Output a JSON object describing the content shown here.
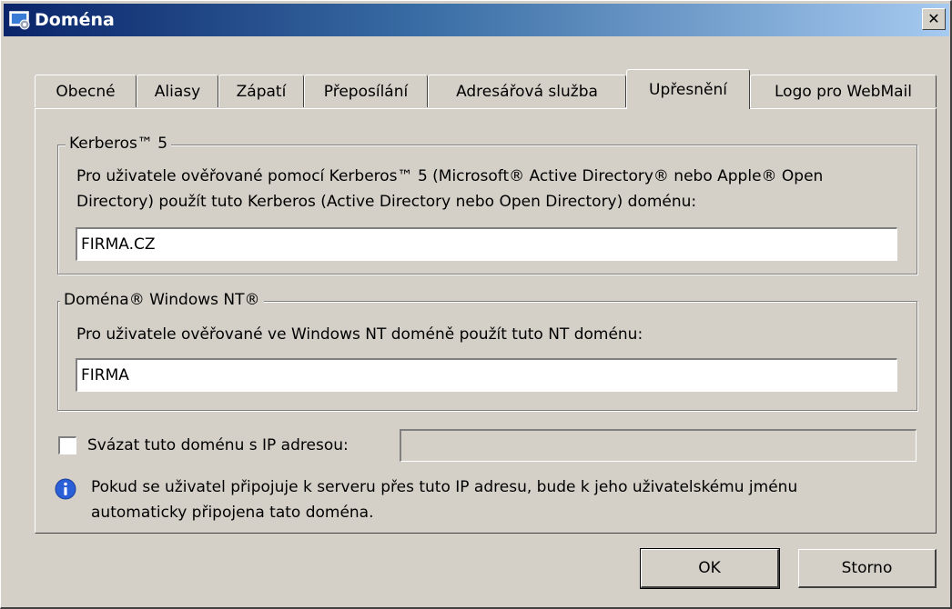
{
  "window": {
    "title": "Doména",
    "close_label": "✕",
    "icon": "domain-app-icon"
  },
  "tabs": [
    {
      "label": "Obecné",
      "active": false
    },
    {
      "label": "Aliasy",
      "active": false
    },
    {
      "label": "Zápatí",
      "active": false
    },
    {
      "label": "Přeposílání",
      "active": false
    },
    {
      "label": "Adresářová služba",
      "active": false
    },
    {
      "label": "Upřesnění",
      "active": true
    },
    {
      "label": "Logo pro WebMail",
      "active": false
    }
  ],
  "kerberos": {
    "legend": "Kerberos™ 5",
    "desc_line1": "Pro uživatele ověřované pomocí Kerberos™ 5 (Microsoft® Active Directory® nebo Apple® Open",
    "desc_line2": "Directory) použít tuto Kerberos (Active Directory nebo Open Directory) doménu:",
    "value": "FIRMA.CZ"
  },
  "nt": {
    "legend": "Doména® Windows NT®",
    "desc": "Pro uživatele ověřované ve Windows NT doméně použít tuto NT doménu:",
    "value": "FIRMA"
  },
  "bind_ip": {
    "label": "Svázat tuto doménu s IP adresou:",
    "checked": false,
    "value": ""
  },
  "info": {
    "icon": "info-icon",
    "line1": "Pokud se uživatel připojuje k serveru přes tuto IP adresu, bude k jeho uživatelskému jménu",
    "line2": "automaticky připojena tato doména."
  },
  "buttons": {
    "ok": "OK",
    "cancel": "Storno"
  },
  "colors": {
    "title_start": "#0a246a",
    "title_end": "#a6caf0",
    "face": "#d4d0c8",
    "info_blue": "#2a5fd8"
  }
}
